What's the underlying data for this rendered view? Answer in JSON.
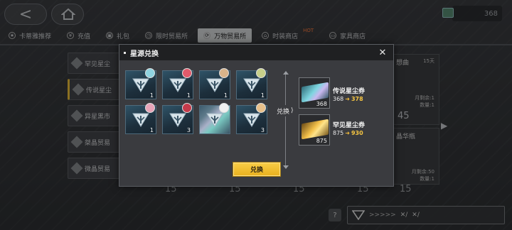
{
  "currency": {
    "amount": "368"
  },
  "tabs": [
    {
      "label": "卡蒂雅推荐",
      "icon": "star-icon",
      "active": false
    },
    {
      "label": "充值",
      "icon": "yen-icon",
      "active": false
    },
    {
      "label": "礼包",
      "icon": "gift-icon",
      "active": false
    },
    {
      "label": "限时贸易所",
      "icon": "clock-icon",
      "active": false
    },
    {
      "label": "万物贸易所",
      "icon": "trade-icon",
      "active": true
    },
    {
      "label": "时装商店",
      "icon": "hanger-icon",
      "active": false,
      "badge": "HOT"
    },
    {
      "label": "家具商店",
      "icon": "sofa-icon",
      "active": false
    }
  ],
  "sidebar": {
    "items": [
      {
        "label": "罕见星尘"
      },
      {
        "label": "传说星尘"
      },
      {
        "label": "异星黑市"
      },
      {
        "label": "桀晶贸易"
      },
      {
        "label": "微晶贸易"
      }
    ]
  },
  "background_cards": {
    "card1": {
      "title": "想曲",
      "timer": "15天",
      "limit": "月剩余:1",
      "stock": "数量:1",
      "price": "45"
    },
    "card2": {
      "title": "晶华瓶",
      "limit": "月剩余:50",
      "stock": "数量:1"
    },
    "bottom_prices": [
      "15",
      "15",
      "15",
      "15",
      "15"
    ]
  },
  "modal": {
    "title": "星源兑换",
    "exchange_label": "兑换",
    "confirm_label": "兑换",
    "tiles": [
      {
        "qty": "1",
        "rainbow": false,
        "avatar_color": "#8fd3e0"
      },
      {
        "qty": "1",
        "rainbow": false,
        "avatar_color": "#e05a6b"
      },
      {
        "qty": "1",
        "rainbow": false,
        "avatar_color": "#d9b48a"
      },
      {
        "qty": "1",
        "rainbow": false,
        "avatar_color": "#c7d08a"
      },
      {
        "qty": "1",
        "rainbow": false,
        "avatar_color": "#e8a4b8"
      },
      {
        "qty": "3",
        "rainbow": false,
        "avatar_color": "#c43a4a"
      },
      {
        "qty": "",
        "rainbow": true,
        "avatar_color": "#f0f0f0"
      },
      {
        "qty": "3",
        "rainbow": false,
        "avatar_color": "#e8c08a"
      }
    ],
    "rewards": [
      {
        "name": "传说星尘券",
        "qty": "368",
        "before": "368",
        "after": "378",
        "style": "cyan"
      },
      {
        "name": "罕见星尘券",
        "qty": "875",
        "before": "875",
        "after": "930",
        "style": "gold"
      }
    ]
  },
  "bottom_bar": {
    "label_a": "✕/",
    "label_b": "✕/"
  },
  "colors": {
    "accent": "#f5c542",
    "confirm_button": "#f0c030"
  }
}
